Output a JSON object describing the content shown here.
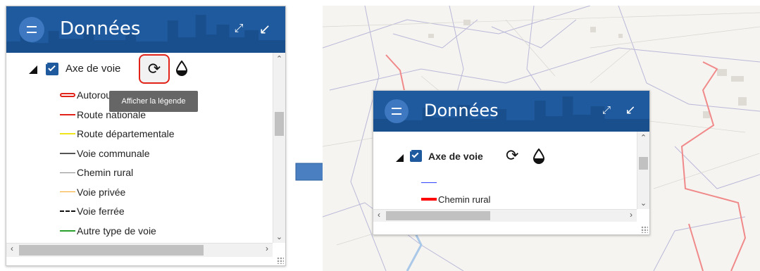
{
  "left_panel": {
    "title": "Données",
    "layer_name": "Axe de voie",
    "tooltip": "Afficher la légende",
    "icons": {
      "menu": "menu-icon",
      "expand": "expand-icon",
      "collapse": "collapse-arrow-icon",
      "refresh": "refresh-icon",
      "opacity": "opacity-drop-icon",
      "triangle": "collapse-triangle-icon"
    },
    "legend": [
      {
        "label": "Autoroute",
        "color": "#e2231a",
        "style": "outline"
      },
      {
        "label": "Route nationale",
        "color": "#e2231a",
        "style": "solid"
      },
      {
        "label": "Route départementale",
        "color": "#f0e51a",
        "style": "solid"
      },
      {
        "label": "Voie communale",
        "color": "#555555",
        "style": "solid"
      },
      {
        "label": "Chemin rural",
        "color": "#888888",
        "style": "thin"
      },
      {
        "label": "Voie privée",
        "color": "#f5a623",
        "style": "thin"
      },
      {
        "label": "Voie ferrée",
        "color": "#111111",
        "style": "dashed"
      },
      {
        "label": "Autre type de voie",
        "color": "#2ca02c",
        "style": "solid"
      }
    ]
  },
  "right_panel": {
    "title": "Données",
    "layer_name": "Axe de voie",
    "legend": [
      {
        "label": "",
        "color": "#3344ff",
        "style": "thin"
      },
      {
        "label": "Chemin rural",
        "color": "#ff0000",
        "style": "thick"
      }
    ]
  },
  "colors": {
    "header": "#1f5a9e",
    "highlight": "#e2231a",
    "arrow": "#4a7fc1"
  }
}
